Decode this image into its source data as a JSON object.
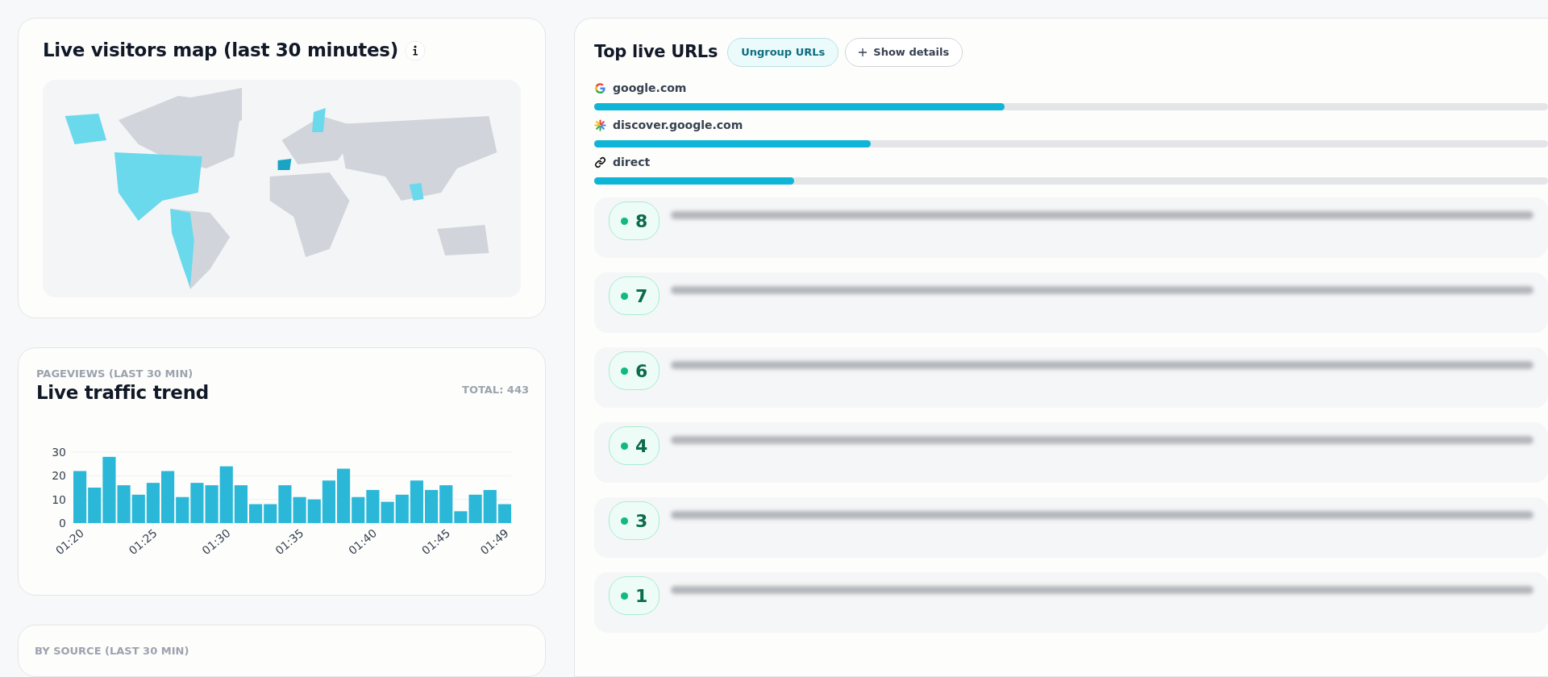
{
  "map_card": {
    "title": "Live visitors map (last 30 minutes)"
  },
  "traffic_card": {
    "overline": "PAGEVIEWS (LAST 30 MIN)",
    "title": "Live traffic trend",
    "total": "TOTAL: 443",
    "chart_data": {
      "type": "bar",
      "ylim": [
        0,
        30
      ],
      "yticks": [
        0,
        10,
        20,
        30
      ],
      "categories": [
        "01:20",
        null,
        null,
        null,
        null,
        "01:25",
        null,
        null,
        null,
        null,
        "01:30",
        null,
        null,
        null,
        null,
        "01:35",
        null,
        null,
        null,
        null,
        "01:40",
        null,
        null,
        null,
        null,
        "01:45",
        null,
        null,
        null,
        "01:49"
      ],
      "values": [
        22,
        15,
        28,
        16,
        12,
        17,
        22,
        11,
        17,
        16,
        24,
        16,
        8,
        8,
        16,
        11,
        10,
        18,
        23,
        11,
        14,
        9,
        12,
        18,
        14,
        16,
        5,
        12,
        14,
        8
      ]
    }
  },
  "source_card": {
    "overline": "BY SOURCE (LAST 30 MIN)"
  },
  "urls_card": {
    "title": "Top live URLs",
    "buttons": [
      {
        "label": "Ungroup URLs",
        "kind": "toggle"
      },
      {
        "label": "Show details",
        "kind": "add"
      }
    ],
    "sources": [
      {
        "name": "google.com",
        "kind": "google",
        "level": 0.43
      },
      {
        "name": "discover.google.com",
        "kind": "discover",
        "level": 0.29
      },
      {
        "name": "direct",
        "kind": "direct",
        "level": 0.21
      }
    ],
    "pages": [
      {
        "visitors": "8"
      },
      {
        "visitors": "7"
      },
      {
        "visitors": "6"
      },
      {
        "visitors": "4"
      },
      {
        "visitors": "3"
      },
      {
        "visitors": "1"
      }
    ]
  }
}
